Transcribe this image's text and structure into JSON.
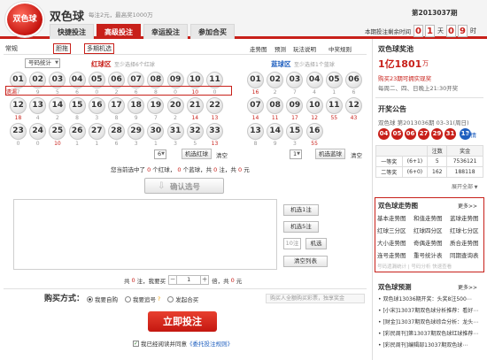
{
  "header": {
    "logo_text": "双色球",
    "lottery_name": "双色球",
    "description": "每注2元，最高奖1000万",
    "issue": "第2013037期",
    "countdown_label": "本期投注剩余时间",
    "countdown": {
      "d": "0",
      "h1": "0",
      "h2": "1",
      "unit_h": "天",
      "hh1": "0",
      "hh2": "9",
      "unit_m": "时"
    }
  },
  "main_tabs": [
    {
      "label": "快捷投注"
    },
    {
      "label": "高级投注"
    },
    {
      "label": "幸运投注"
    },
    {
      "label": "参加合买"
    }
  ],
  "sub_tabs": {
    "normal": "常规",
    "dantuo": "胆拖",
    "multi": "多期机选",
    "links": [
      "走势图",
      "预测",
      "玩法说明",
      "中奖规则"
    ]
  },
  "red_zone": {
    "stat_select": "号码统计",
    "label": "红球区",
    "hint": "至少选择6个红球",
    "numbers": [
      "01",
      "02",
      "03",
      "04",
      "05",
      "06",
      "07",
      "08",
      "09",
      "10",
      "11",
      "12",
      "13",
      "14",
      "15",
      "16",
      "17",
      "18",
      "19",
      "20",
      "21",
      "22",
      "23",
      "24",
      "25",
      "26",
      "27",
      "28",
      "29",
      "30",
      "31",
      "32",
      "33"
    ],
    "miss_label": "遗漏",
    "misses": [
      "7",
      "9",
      "5",
      "6",
      "0",
      "2",
      "6",
      "8",
      "0",
      "10",
      "0",
      "18",
      "4",
      "2",
      "8",
      "3",
      "8",
      "9",
      "7",
      "2",
      "14",
      "13",
      "0",
      "0",
      "10",
      "1",
      "1",
      "6",
      "3",
      "1",
      "3",
      "5",
      "13"
    ],
    "count_select": "6",
    "random_button": "机选红球",
    "clear": "清空"
  },
  "blue_zone": {
    "label": "蓝球区",
    "hint": "至少选择1个蓝球",
    "numbers": [
      "01",
      "02",
      "03",
      "04",
      "05",
      "06",
      "07",
      "08",
      "09",
      "10",
      "11",
      "12",
      "13",
      "14",
      "15",
      "16"
    ],
    "misses": [
      "16",
      "2",
      "7",
      "4",
      "1",
      "6",
      "14",
      "11",
      "17",
      "12",
      "55",
      "43",
      "8",
      "9",
      "3",
      "55"
    ],
    "count_select": "1",
    "random_button": "机选蓝球",
    "clear": "清空"
  },
  "selection_summary": {
    "prefix": "您当前选中了",
    "red_count": "0",
    "red_unit": "个红球，",
    "blue_count": "0",
    "blue_unit": "个蓝球，共",
    "bets": "0",
    "bets_unit": "注，共",
    "amount": "0",
    "amount_unit": "元"
  },
  "confirm_button": "确认选号",
  "random_buttons": {
    "one": "机选1注",
    "five": "机选5注",
    "qty": "10注",
    "go": "机选",
    "clear_list": "清空列表"
  },
  "multiplier_row": {
    "total_prefix": "共",
    "bets": "0",
    "bets_unit": "注，我要买",
    "minus": "－",
    "value": "1",
    "plus": "＋",
    "mult_unit": "倍，共",
    "amount": "0",
    "amount_unit": "元"
  },
  "purchase": {
    "title": "购买方式：",
    "options": [
      "我要自购",
      "我要追号",
      "发起合买"
    ],
    "hint": "购买人全额购买彩票，独享奖金",
    "submit": "立即投注",
    "agree_prefix": "我已经阅读并同意",
    "agree_link": "《委托投注规则》"
  },
  "sidebar": {
    "jackpot_title": "双色球奖池",
    "jackpot_value": "1亿1801",
    "jackpot_unit": "万",
    "jackpot_note": "购买23期可拥实现奖",
    "draw_days": "每周二、四、日晚上21:30开奖",
    "announce_title": "开奖公告",
    "announce_info": "双色球 第2013036期 03-31(周日)",
    "red_balls": [
      "04",
      "05",
      "06",
      "27",
      "29",
      "31"
    ],
    "blue_ball": "13",
    "detail_link": "详情",
    "award_headers": [
      "",
      "注数",
      "奖金"
    ],
    "award_rows": [
      [
        "一等奖",
        "(6+1)",
        "5",
        "7536121"
      ],
      [
        "二等奖",
        "(6+0)",
        "162",
        "188118"
      ]
    ],
    "expand": "展开全部",
    "trend_title": "双色球走势图",
    "trend_more": "更多>>",
    "trend_links": [
      [
        "基本走势图",
        "和值走势图",
        "蓝球走势图"
      ],
      [
        "红球三分区",
        "红球四分区",
        "红球七分区"
      ],
      [
        "大小走势图",
        "奇偶走势图",
        "质合走势图"
      ],
      [
        "连号走势图",
        "重号统计表",
        "同期查询表"
      ]
    ],
    "trend_footer": "号码遗漏统计  |  号码分析  快速查看",
    "predict_title": "双色球预测",
    "predict_more": "更多>>",
    "predict_items": [
      "双色球13036期开奖：头奖8注500⋯",
      "[小宋]13037期双色球分析推荐：看好⋯",
      "[财金]13037期双色球综合分析：龙头⋯",
      "[彩民周刊]第13037期双色球红球推荐⋯",
      "[彩民周刊]编辑部13037期双色球⋯"
    ]
  },
  "colors": {
    "brand_red": "#c8201a",
    "blue": "#1f5fbf"
  }
}
